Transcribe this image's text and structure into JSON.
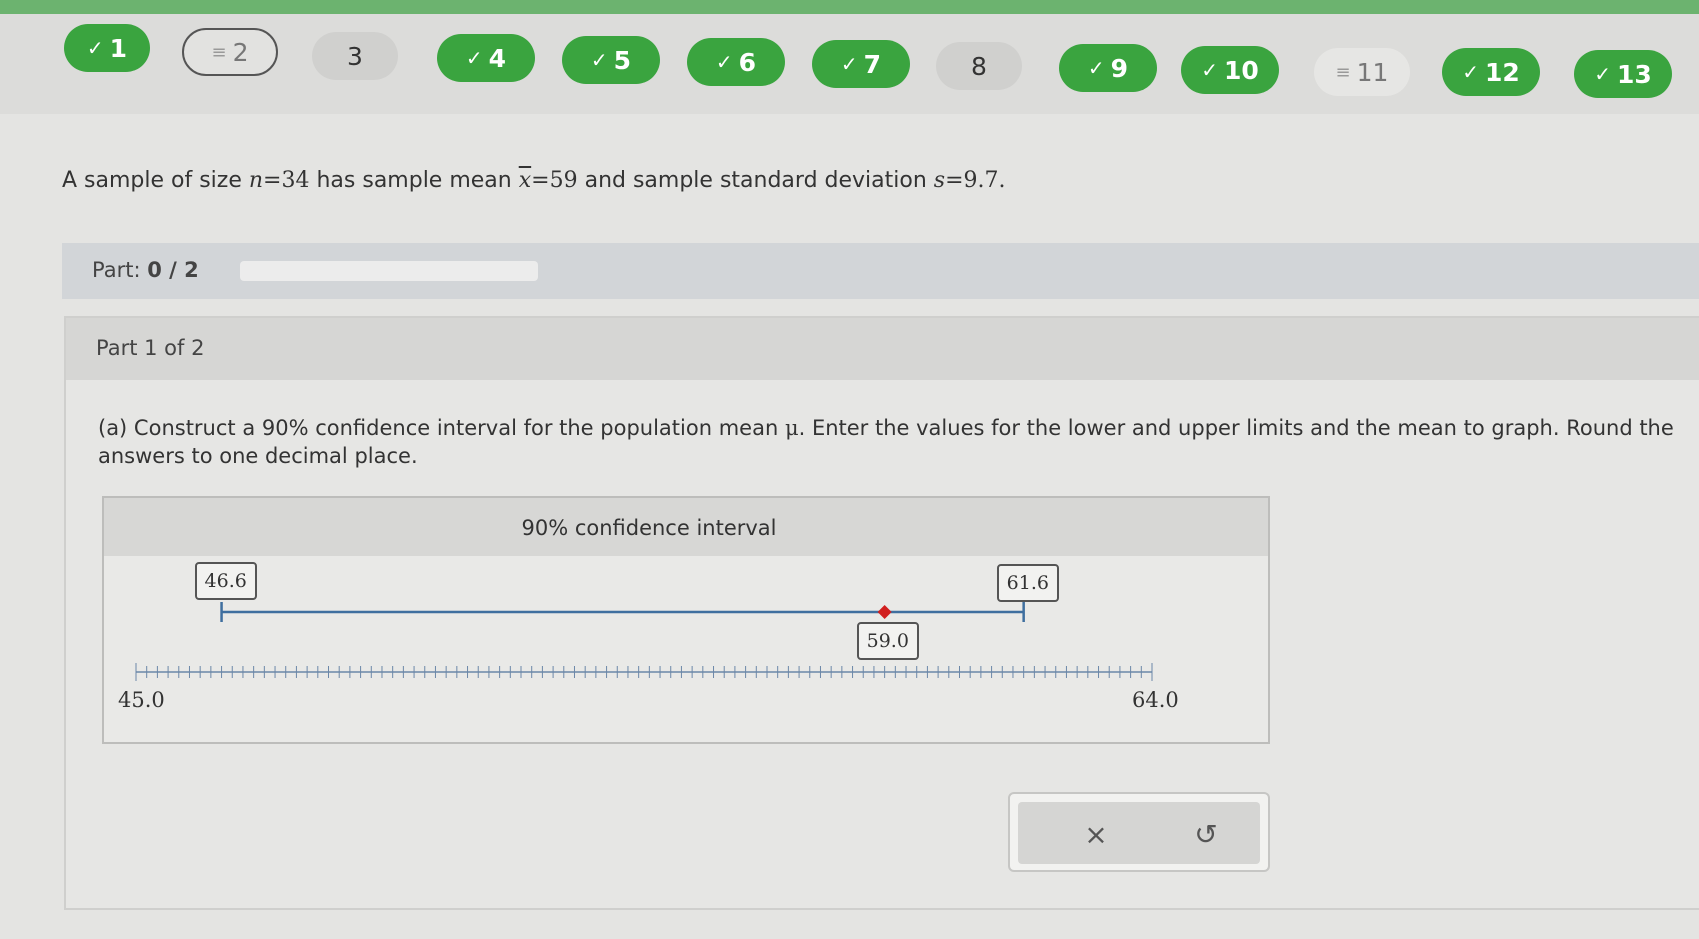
{
  "question_nav": [
    {
      "label": "1",
      "state": "done"
    },
    {
      "label": "2",
      "state": "partial",
      "current": true
    },
    {
      "label": "3",
      "state": "empty"
    },
    {
      "label": "4",
      "state": "done"
    },
    {
      "label": "5",
      "state": "done"
    },
    {
      "label": "6",
      "state": "done"
    },
    {
      "label": "7",
      "state": "done"
    },
    {
      "label": "8",
      "state": "empty"
    },
    {
      "label": "9",
      "state": "done"
    },
    {
      "label": "10",
      "state": "done"
    },
    {
      "label": "11",
      "state": "partial"
    },
    {
      "label": "12",
      "state": "done"
    },
    {
      "label": "13",
      "state": "done"
    }
  ],
  "problem": {
    "t1": "A sample of size ",
    "n_var": "n",
    "eq1": "=34",
    "t2": " has sample mean ",
    "x_var": "x",
    "eq2": "=59",
    "t3": " and sample standard deviation ",
    "s_var": "s",
    "eq3": "=9.7",
    "t4": "."
  },
  "part_progress": {
    "label": "Part:",
    "value": "0 / 2",
    "fraction": 0
  },
  "part": {
    "header": "Part 1 of 2",
    "question_a": "(a) Construct a 90% confidence interval for the population mean ",
    "mu": "μ",
    "question_b": ". Enter the values for the lower and upper limits and the mean to graph. Round the answers to one decimal place."
  },
  "graph": {
    "title": "90% confidence interval",
    "axis_min": "45.0",
    "axis_max": "64.0",
    "lower": "46.6",
    "mean": "59.0",
    "upper": "61.6",
    "axis_range": [
      45.0,
      64.0
    ],
    "tick_step": 0.2,
    "mean_marker_color": "#d11f1f",
    "interval_line_color": "#3f6f9f"
  },
  "actions": {
    "clear_symbol": "×",
    "undo_symbol": "↺"
  }
}
